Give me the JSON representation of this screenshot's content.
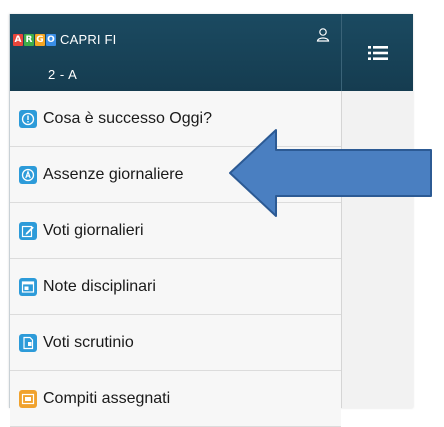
{
  "header": {
    "logo_letters": [
      "A",
      "R",
      "G",
      "O"
    ],
    "logo_colors": [
      "#e8463b",
      "#3fae49",
      "#f5a623",
      "#3a8ee6"
    ],
    "school": "CAPRI FI",
    "class": "2 - A",
    "bg_color": "#1b4a61"
  },
  "menu": {
    "toggle_icon": "hamburger-icon",
    "items": [
      {
        "label": "Cosa è successo Oggi?",
        "icon": "info-icon",
        "color": "#2d9bd9"
      },
      {
        "label": "Assenze giornaliere",
        "icon": "absence-icon",
        "color": "#2d9bd9"
      },
      {
        "label": "Voti giornalieri",
        "icon": "edit-grade-icon",
        "color": "#2d9bd9"
      },
      {
        "label": "Note disciplinari",
        "icon": "note-icon",
        "color": "#2d9bd9"
      },
      {
        "label": "Voti scrutinio",
        "icon": "report-icon",
        "color": "#2d9bd9"
      },
      {
        "label": "Compiti assegnati",
        "icon": "homework-icon",
        "color": "#f0a22e"
      }
    ]
  },
  "annotation": {
    "arrow_color": "#4a7fc1",
    "arrow_target": "Assenze giornaliere"
  }
}
